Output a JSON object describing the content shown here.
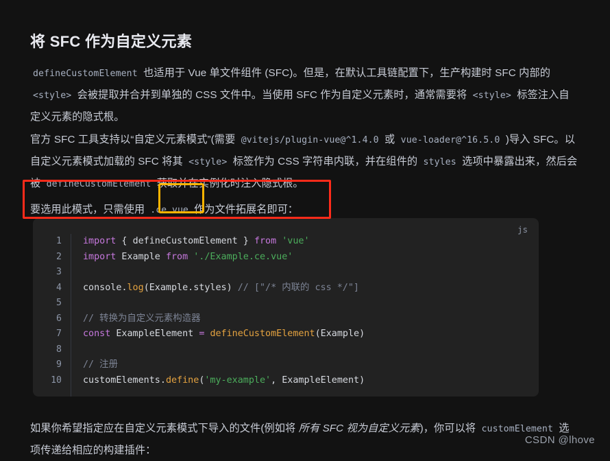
{
  "page": {
    "background": "#121212",
    "title": "将 SFC 作为自定义元素"
  },
  "paragraph_1": {
    "code_1": "defineCustomElement",
    "text_1": " 也适用于 Vue 单文件组件 (SFC)。但是，在默认工具链配置下，生产构建时 SFC 内部的 ",
    "code_2": "<style>",
    "text_2": " 会被提取并合并到单独的 CSS 文件中。当使用 SFC 作为自定义元素时，通常需要将 ",
    "code_3": "<style>",
    "text_3": " 标签注入自定义元素的隐式根。"
  },
  "paragraph_2": {
    "text_1": "官方 SFC 工具支持以“自定义元素模式”(需要 ",
    "code_1": "@vitejs/plugin-vue@^1.4.0",
    "text_2": " 或 ",
    "code_2": "vue-loader@^16.5.0",
    "text_3": " )导入 SFC。以自定义元素模式加载的 SFC 将其 ",
    "code_3": "<style>",
    "text_4": " 标签作为 CSS 字符串内联，并在组件的 ",
    "code_4": "styles",
    "text_5": " 选项中暴露出来，然后会被 ",
    "code_5": "defineCustomElement",
    "text_6": " 获取并在实例化时注入隐式根。"
  },
  "paragraph_3": {
    "text_1": "要选用此模式，只需使用 ",
    "code_1": ".ce.vue",
    "text_2": " 作为文件拓展名即可：",
    "highlight_box_color": "#ff2b1a",
    "code_box_color": "#ffb400"
  },
  "code_block": {
    "language": "js",
    "background": "#222222",
    "line_numbers": [
      "1",
      "2",
      "3",
      "4",
      "5",
      "6",
      "7",
      "8",
      "9",
      "10"
    ],
    "lines": [
      {
        "n": "1",
        "tokens": [
          {
            "t": "import",
            "c": "t-kw"
          },
          {
            "t": " { ",
            "c": "t-pun"
          },
          {
            "t": "defineCustomElement",
            "c": "t-var"
          },
          {
            "t": " } ",
            "c": "t-pun"
          },
          {
            "t": "from",
            "c": "t-kw"
          },
          {
            "t": " ",
            "c": "t-pun"
          },
          {
            "t": "'vue'",
            "c": "t-str"
          }
        ]
      },
      {
        "n": "2",
        "tokens": [
          {
            "t": "import",
            "c": "t-kw"
          },
          {
            "t": " Example ",
            "c": "t-var"
          },
          {
            "t": "from",
            "c": "t-kw"
          },
          {
            "t": " ",
            "c": "t-pun"
          },
          {
            "t": "'./Example.ce.vue'",
            "c": "t-str"
          }
        ]
      },
      {
        "n": "3",
        "tokens": []
      },
      {
        "n": "4",
        "tokens": [
          {
            "t": "console",
            "c": "t-var"
          },
          {
            "t": ".",
            "c": "t-pun"
          },
          {
            "t": "log",
            "c": "t-fn"
          },
          {
            "t": "(Example.styles) ",
            "c": "t-pun"
          },
          {
            "t": "// [\"/* 内联的 css */\"]",
            "c": "t-com"
          }
        ]
      },
      {
        "n": "5",
        "tokens": []
      },
      {
        "n": "6",
        "tokens": [
          {
            "t": "// 转换为自定义元素构造器",
            "c": "t-com"
          }
        ]
      },
      {
        "n": "7",
        "tokens": [
          {
            "t": "const",
            "c": "t-kw"
          },
          {
            "t": " ExampleElement ",
            "c": "t-var"
          },
          {
            "t": "=",
            "c": "t-op"
          },
          {
            "t": " ",
            "c": "t-pun"
          },
          {
            "t": "defineCustomElement",
            "c": "t-fn"
          },
          {
            "t": "(Example)",
            "c": "t-pun"
          }
        ]
      },
      {
        "n": "8",
        "tokens": []
      },
      {
        "n": "9",
        "tokens": [
          {
            "t": "// 注册",
            "c": "t-com"
          }
        ]
      },
      {
        "n": "10",
        "tokens": [
          {
            "t": "customElements",
            "c": "t-var"
          },
          {
            "t": ".",
            "c": "t-pun"
          },
          {
            "t": "define",
            "c": "t-fn"
          },
          {
            "t": "(",
            "c": "t-pun"
          },
          {
            "t": "'my-example'",
            "c": "t-str"
          },
          {
            "t": ", ExampleElement)",
            "c": "t-pun"
          }
        ]
      }
    ]
  },
  "paragraph_4": {
    "text_1": "如果你希望指定应在自定义元素模式下导入的文件(例如将 ",
    "italic_1": "所有 SFC 视为自定义元素",
    "text_2": ")，你可以将 ",
    "code_1": "customElement",
    "text_3": " 选项传递给相应的构建插件："
  },
  "watermark": {
    "text": "CSDN @lhove"
  }
}
